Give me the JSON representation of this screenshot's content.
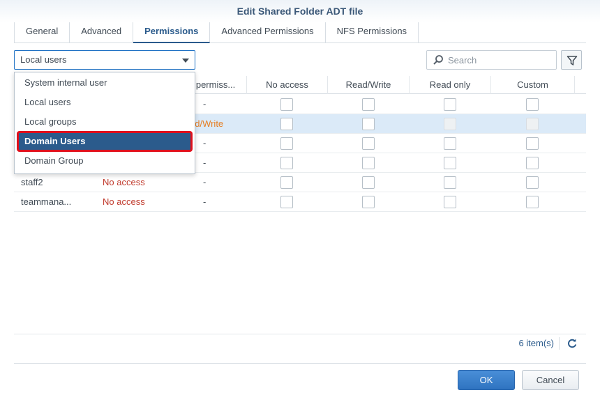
{
  "window": {
    "title": "Edit Shared Folder ADT file"
  },
  "tabs": [
    {
      "label": "General"
    },
    {
      "label": "Advanced"
    },
    {
      "label": "Permissions"
    },
    {
      "label": "Advanced Permissions"
    },
    {
      "label": "NFS Permissions"
    }
  ],
  "user_type_select": {
    "value": "Local users",
    "options": [
      "System internal user",
      "Local users",
      "Local groups",
      "Domain Users",
      "Domain Group"
    ],
    "highlighted": "Domain Users"
  },
  "search": {
    "placeholder": "Search",
    "value": ""
  },
  "grid": {
    "columns": [
      "o permiss...",
      "No access",
      "Read/Write",
      "Read only",
      "Custom"
    ],
    "rows": [
      {
        "name": "",
        "preview": "",
        "perm": "-",
        "selected": false
      },
      {
        "name": "",
        "preview": "",
        "perm": "ad/Write",
        "selected": true
      },
      {
        "name": "",
        "preview": "",
        "perm": "-",
        "selected": false
      },
      {
        "name": "",
        "preview": "",
        "perm": "-",
        "selected": false
      },
      {
        "name": "staff2",
        "preview": "No access",
        "perm": "-",
        "selected": false
      },
      {
        "name": "teammana...",
        "preview": "No access",
        "perm": "-",
        "selected": false
      }
    ]
  },
  "footer": {
    "item_count": "6 item(s)"
  },
  "buttons": {
    "ok": "OK",
    "cancel": "Cancel"
  },
  "colors": {
    "accent": "#2b5b8c",
    "no_access": "#c0392b",
    "read_write": "#e67e22",
    "highlight_border": "#e0101c"
  }
}
